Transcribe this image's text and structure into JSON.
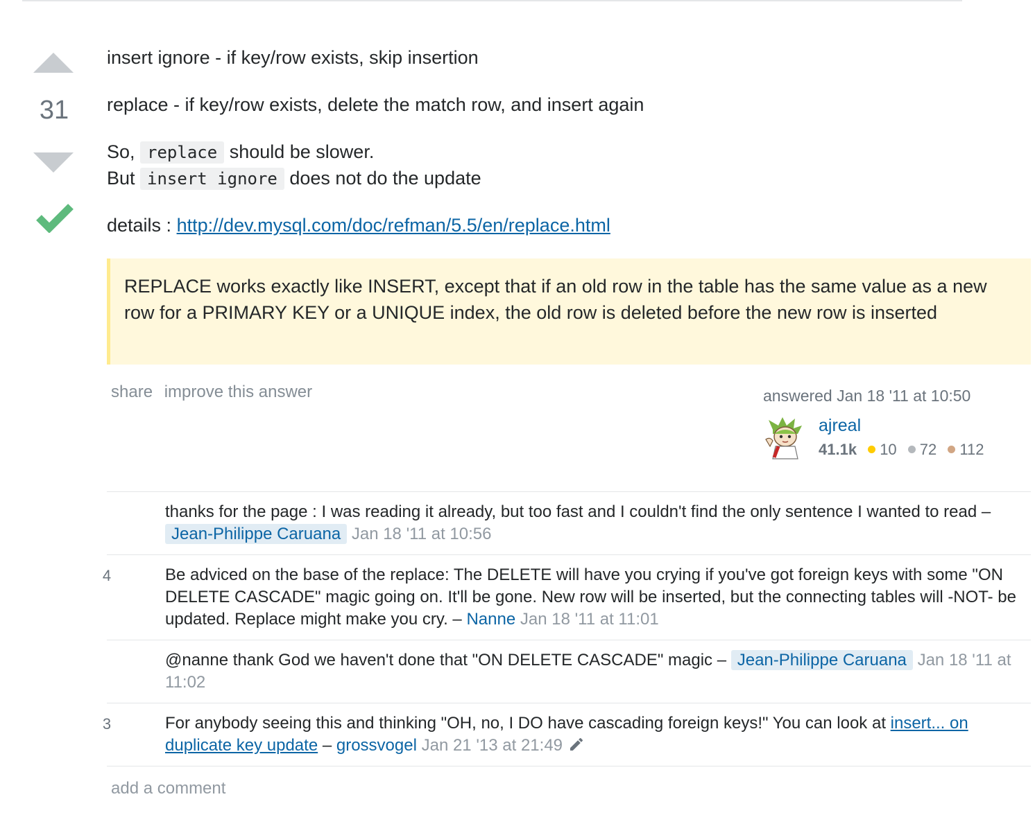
{
  "vote": {
    "score": "31",
    "accepted": true
  },
  "post": {
    "line1": "insert ignore - if key/row exists, skip insertion",
    "line2": "replace - if key/row exists, delete the match row, and insert again",
    "line3_pre": "So, ",
    "line3_code": "replace",
    "line3_post": " should be slower.",
    "line4_pre": "But ",
    "line4_code": "insert ignore",
    "line4_post": " does not do the update",
    "details_label": "details : ",
    "details_link": "http://dev.mysql.com/doc/refman/5.5/en/replace.html",
    "quote": "REPLACE works exactly like INSERT, except that if an old row in the table has the same value as a new row for a PRIMARY KEY or a UNIQUE index, the old row is deleted before the new row is inserted"
  },
  "menu": {
    "share": "share",
    "improve": "improve this answer"
  },
  "signature": {
    "action_time": "answered Jan 18 '11 at 10:50",
    "user_name": "ajreal",
    "reputation": "41.1k",
    "gold": "10",
    "silver": "72",
    "bronze": "112"
  },
  "colors": {
    "gold": "#ffcc01",
    "silver": "#b4b8bc",
    "bronze": "#d1a684",
    "accepted": "#5eba7d",
    "link": "#0c65a5"
  },
  "comments": [
    {
      "score": "",
      "text": "thanks for the page : I was reading it already, but too fast and I couldn't find the only sentence I wanted to read",
      "dash": " – ",
      "user": "Jean-Philippe Caruana",
      "date": "Jan 18 '11 at 10:56"
    },
    {
      "score": "4",
      "text": "Be adviced on the base of the replace: The DELETE will have you crying if you've got foreign keys with some \"ON DELETE CASCADE\" magic going on. It'll be gone. New row will be inserted, but the connecting tables will -NOT- be updated. Replace might make you cry.",
      "dash": " – ",
      "user": "Nanne",
      "date": "Jan 18 '11 at 11:01"
    },
    {
      "score": "",
      "text": "@nanne thank God we haven't done that \"ON DELETE CASCADE\" magic",
      "dash": " – ",
      "user": "Jean-Philippe Caruana",
      "date": "Jan 18 '11 at 11:02"
    },
    {
      "score": "3",
      "text": "For anybody seeing this and thinking \"OH, no, I DO have cascading foreign keys!\" You can look at ",
      "link": "insert... on duplicate key update",
      "dash": " – ",
      "user": "grossvogel",
      "date": "Jan 21 '13 at 21:49"
    }
  ],
  "add_comment": "add a comment"
}
